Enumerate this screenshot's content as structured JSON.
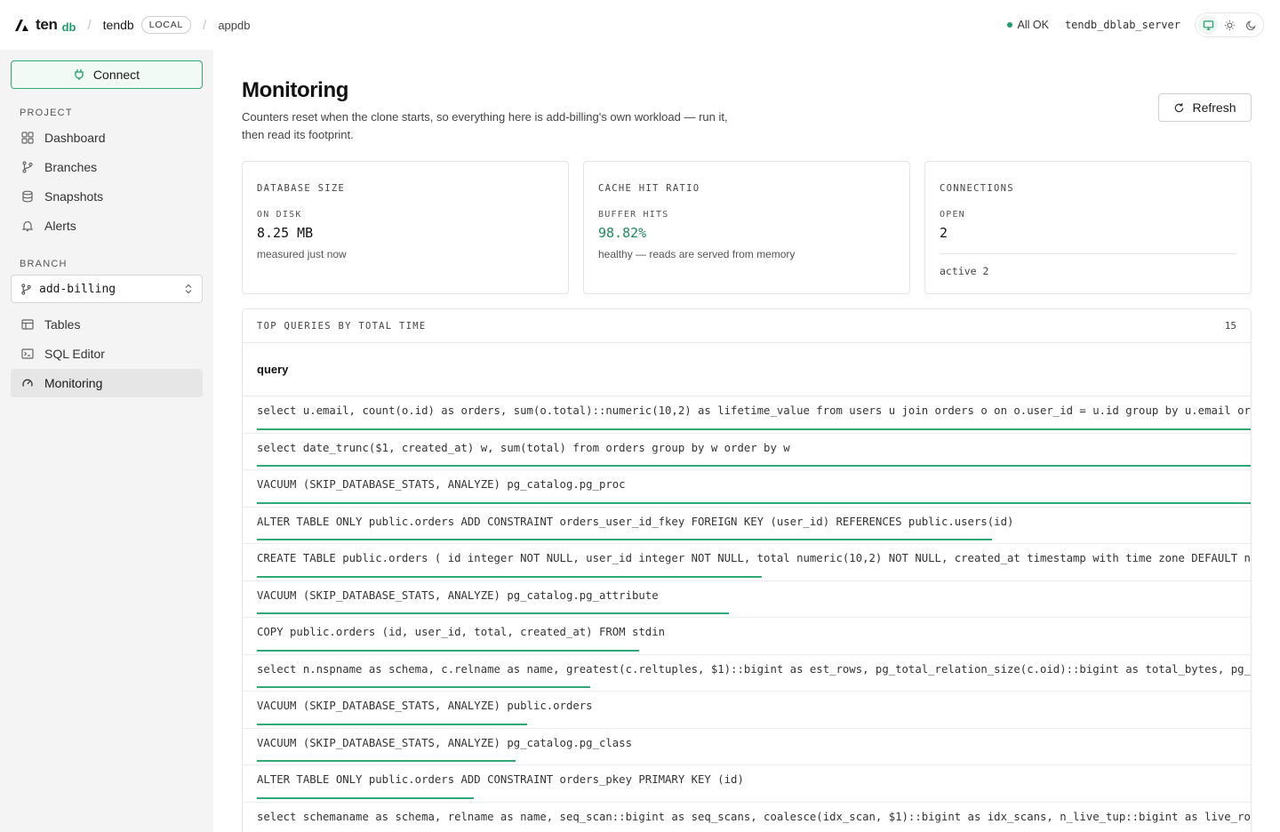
{
  "header": {
    "logo_text": "ten",
    "logo_sub": "db",
    "project": "tendb",
    "env_badge": "LOCAL",
    "database": "appdb",
    "status": "All OK",
    "server": "tendb_dblab_server"
  },
  "sidebar": {
    "connect_label": "Connect",
    "project_section": "PROJECT",
    "project_items": [
      {
        "label": "Dashboard",
        "icon": "grid-icon"
      },
      {
        "label": "Branches",
        "icon": "git-branch-icon"
      },
      {
        "label": "Snapshots",
        "icon": "database-icon"
      },
      {
        "label": "Alerts",
        "icon": "bell-icon"
      }
    ],
    "branch_section": "BRANCH",
    "branch_value": "add-billing",
    "branch_items": [
      {
        "label": "Tables",
        "icon": "table-icon"
      },
      {
        "label": "SQL Editor",
        "icon": "terminal-icon"
      },
      {
        "label": "Monitoring",
        "icon": "gauge-icon",
        "active": true
      }
    ]
  },
  "main": {
    "title": "Monitoring",
    "description": "Counters reset when the clone starts, so everything here is add-billing's own workload — run it, then read its footprint.",
    "refresh_label": "Refresh",
    "stats": {
      "db_size": {
        "title": "DATABASE SIZE",
        "sub": "ON DISK",
        "value": "8.25 MB",
        "note": "measured just now"
      },
      "cache": {
        "title": "CACHE HIT RATIO",
        "sub": "BUFFER HITS",
        "value": "98.82%",
        "note": "healthy — reads are served from memory"
      },
      "connections": {
        "title": "CONNECTIONS",
        "sub": "OPEN",
        "value": "2",
        "active": "active 2"
      }
    },
    "queries": {
      "title": "TOP QUERIES BY TOTAL TIME",
      "count": "15",
      "column": "query",
      "accent": "#2faa77",
      "rows": [
        {
          "text": "select u.email, count(o.id) as orders, sum(o.total)::numeric(10,2) as lifetime_value from users u join orders o on o.user_id = u.id group by u.email order by lifetime_value desc",
          "share": 1.0
        },
        {
          "text": "select date_trunc($1, created_at) w, sum(total) from orders group by w order by w",
          "share": 1.0
        },
        {
          "text": "VACUUM (SKIP_DATABASE_STATS, ANALYZE) pg_catalog.pg_proc",
          "share": 1.0
        },
        {
          "text": "ALTER TABLE ONLY public.orders ADD CONSTRAINT orders_user_id_fkey FOREIGN KEY (user_id) REFERENCES public.users(id)",
          "share": 0.74
        },
        {
          "text": "CREATE TABLE public.orders ( id integer NOT NULL, user_id integer NOT NULL, total numeric(10,2) NOT NULL, created_at timestamp with time zone DEFAULT now() NOT NULL )",
          "share": 0.508
        },
        {
          "text": "VACUUM (SKIP_DATABASE_STATS, ANALYZE) pg_catalog.pg_attribute",
          "share": 0.475
        },
        {
          "text": "COPY public.orders (id, user_id, total, created_at) FROM stdin",
          "share": 0.385
        },
        {
          "text": "select n.nspname as schema, c.relname as name, greatest(c.reltuples, $1)::bigint as est_rows, pg_total_relation_size(c.oid)::bigint as total_bytes, pg_indexes_size(c.oid)::bigint as index_bytes",
          "share": 0.335
        },
        {
          "text": "VACUUM (SKIP_DATABASE_STATS, ANALYZE) public.orders",
          "share": 0.272
        },
        {
          "text": "VACUUM (SKIP_DATABASE_STATS, ANALYZE) pg_catalog.pg_class",
          "share": 0.26
        },
        {
          "text": "ALTER TABLE ONLY public.orders ADD CONSTRAINT orders_pkey PRIMARY KEY (id)",
          "share": 0.218
        },
        {
          "text": "select schemaname as schema, relname as name, seq_scan::bigint as seq_scans, coalesce(idx_scan, $1)::bigint as idx_scans, n_live_tup::bigint as live_rows, n_dead_tup::bigint as dead_rows",
          "share": 0.21
        }
      ]
    }
  }
}
